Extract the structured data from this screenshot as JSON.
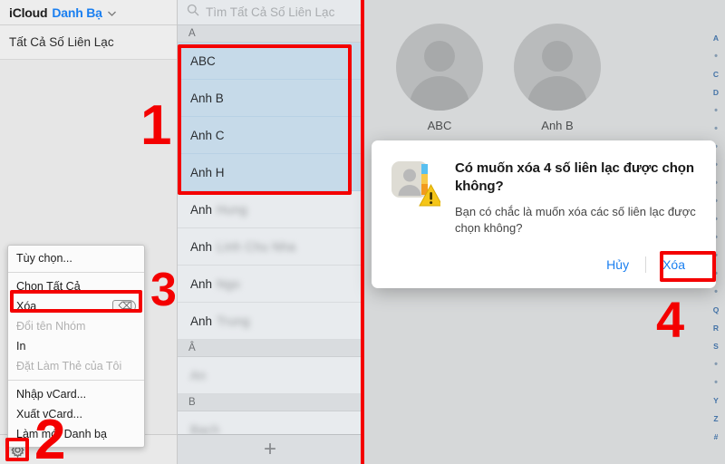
{
  "sidebar": {
    "brand_primary": "iCloud",
    "brand_app": "Danh Bạ",
    "chevron": "⌄",
    "group_label": "Tất Cả Số Liên Lạc",
    "gear_icon": "gear-icon"
  },
  "search": {
    "placeholder": "Tìm Tất Cả Số Liên Lạc",
    "icon": "search-icon"
  },
  "list": {
    "add_button": "+",
    "sections": [
      {
        "letter": "A",
        "contacts": [
          {
            "name": "ABC",
            "selected": true,
            "blurred": false
          },
          {
            "name": "Anh B",
            "selected": true,
            "blurred": false
          },
          {
            "name": "Anh C",
            "selected": true,
            "blurred": false
          },
          {
            "name": "Anh H",
            "selected": true,
            "blurred": false
          },
          {
            "name": "Anh",
            "blur_suffix": "Hung",
            "selected": false,
            "blurred": true
          },
          {
            "name": "Anh",
            "blur_suffix": "Linh Chu Nha",
            "selected": false,
            "blurred": true
          },
          {
            "name": "Anh",
            "blur_suffix": "Ngo",
            "selected": false,
            "blurred": true
          },
          {
            "name": "Anh",
            "blur_suffix": "Trung",
            "selected": false,
            "blurred": true
          }
        ]
      },
      {
        "letter": "Â",
        "contacts": [
          {
            "name": "",
            "blur_suffix": "An",
            "selected": false,
            "blurred": true
          }
        ]
      },
      {
        "letter": "B",
        "contacts": [
          {
            "name": "",
            "blur_suffix": "Bach",
            "selected": false,
            "blurred": true
          }
        ]
      }
    ]
  },
  "alphabet_index": [
    "A",
    "•",
    "C",
    "D",
    "•",
    "•",
    "•",
    "•",
    "•",
    "•",
    "•",
    "•",
    "•",
    "•",
    "•",
    "Q",
    "R",
    "S",
    "•",
    "•",
    "Y",
    "Z",
    "#"
  ],
  "detail": {
    "avatars": [
      {
        "label": "ABC",
        "icon": "person-avatar-icon"
      },
      {
        "label": "Anh B",
        "icon": "person-avatar-icon"
      }
    ]
  },
  "context_menu": {
    "items": [
      {
        "label": "Tùy chọn...",
        "disabled": false,
        "shortcut": ""
      },
      {
        "separator": true
      },
      {
        "label": "Chọn Tất Cả",
        "disabled": false,
        "shortcut": ""
      },
      {
        "label": "Xóa",
        "disabled": false,
        "shortcut": "⌫",
        "highlighted": true
      },
      {
        "label": "Đổi tên Nhóm",
        "disabled": true,
        "shortcut": ""
      },
      {
        "label": "In",
        "disabled": false,
        "shortcut": ""
      },
      {
        "label": "Đặt Làm Thẻ của Tôi",
        "disabled": true,
        "shortcut": ""
      },
      {
        "separator": true
      },
      {
        "label": "Nhập vCard...",
        "disabled": false,
        "shortcut": ""
      },
      {
        "label": "Xuất vCard...",
        "disabled": false,
        "shortcut": ""
      },
      {
        "label": "Làm mới Danh bạ",
        "disabled": false,
        "shortcut": ""
      }
    ]
  },
  "dialog": {
    "icon": "contacts-warning-icon",
    "title": "Có muốn xóa 4 số liên lạc được chọn không?",
    "message": "Bạn có chắc là muốn xóa các số liên lạc được chọn không?",
    "cancel_label": "Hủy",
    "confirm_label": "Xóa"
  },
  "annotations": {
    "step1": "1",
    "step2": "2",
    "step3": "3",
    "step4": "4",
    "color": "#f40000"
  }
}
